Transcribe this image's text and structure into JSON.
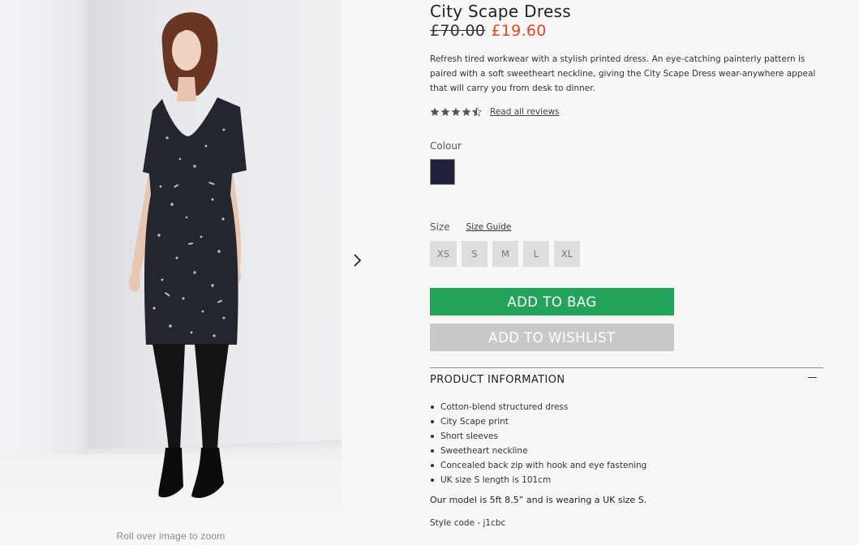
{
  "gallery": {
    "zoom_hint": "Roll over image to zoom",
    "next_icon": "chevron-right-icon",
    "image_alt": "Model wearing the City Scape Dress"
  },
  "product": {
    "title": "City Scape Dress",
    "price_original": "£70.00",
    "price_sale": "£19.60",
    "description": "Refresh tired workwear with a stylish printed dress. An eye-catching painterly pattern is paired with a soft sweetheart neckline, giving the City Scape Dress wear-anywhere appeal that will carry you from desk to dinner.",
    "rating": {
      "value": 4.5,
      "max": 5,
      "icon": "star-icon",
      "reviews_link": "Read all reviews"
    },
    "colour": {
      "label": "Colour",
      "swatch_color": "#1d1f3b"
    },
    "size": {
      "label": "Size",
      "guide_link": "Size Guide",
      "options": [
        "XS",
        "S",
        "M",
        "L",
        "XL"
      ]
    },
    "buttons": {
      "add_to_bag": "ADD TO BAG",
      "add_to_wishlist": "ADD TO WISHLIST"
    },
    "info": {
      "heading": "PRODUCT INFORMATION",
      "toggle_icon": "minus-icon",
      "features": [
        "Cotton-blend structured dress",
        "City Scape print",
        "Short sleeves",
        "Sweetheart neckline",
        "Concealed back zip with hook and eye fastening",
        "UK size S length is 101cm"
      ],
      "model_note": "Our model is 5ft 8.5” and is wearing a UK size S.",
      "style_code": "Style code - j1cbc"
    }
  },
  "colors": {
    "accent_green": "#24a35a",
    "sale_red": "#e8461c",
    "wishlist_grey": "#c9c9c9",
    "size_box_grey": "#dedede"
  }
}
